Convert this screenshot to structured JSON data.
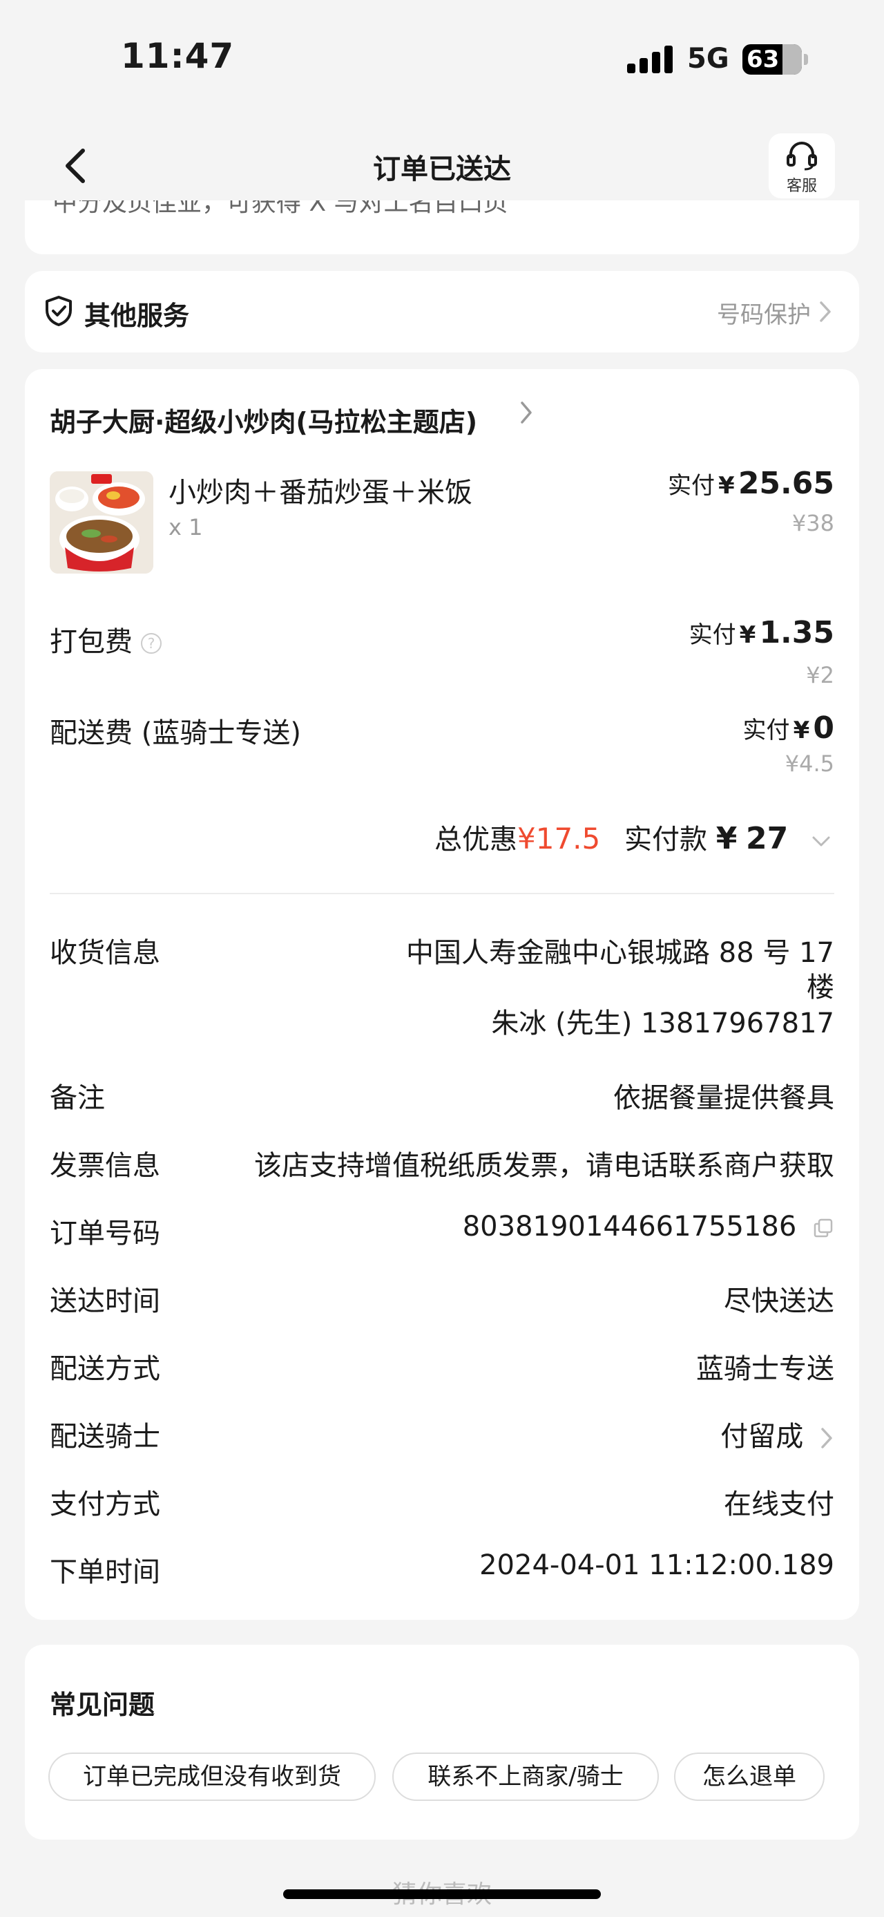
{
  "status_bar": {
    "time": "11:47",
    "network": "5G",
    "battery": "63"
  },
  "nav": {
    "title": "订单已送达",
    "service_label": "客服"
  },
  "partial_text": "中分及页佳业，可获得 X 与对工名目口页",
  "other_services": {
    "title": "其他服务",
    "link": "号码保护"
  },
  "shop": {
    "name": "胡子大厨·超级小炒肉(马拉松主题店)"
  },
  "item": {
    "name": "小炒肉＋番茄炒蛋＋米饭",
    "qty": "x 1",
    "paid_prefix": "实付",
    "paid_yen": "¥",
    "paid_amount": "25.65",
    "original": "¥38"
  },
  "packing_fee": {
    "label": "打包费",
    "paid_prefix": "实付",
    "paid_yen": "¥",
    "paid_amount": "1.35",
    "original": "¥2"
  },
  "delivery_fee": {
    "label": "配送费 (蓝骑士专送)",
    "paid_prefix": "实付",
    "paid_yen": "¥",
    "paid_amount": "0",
    "original": "¥4.5"
  },
  "totals": {
    "discount_label": "总优惠",
    "discount_value": "¥17.5",
    "pay_label": "实付款",
    "pay_yen": "¥",
    "pay_value": "27"
  },
  "info": {
    "address_label": "收货信息",
    "address_line1": "中国人寿金融中心银城路 88 号 17",
    "address_line2": "楼",
    "contact": "朱冰 (先生) 13817967817",
    "note_label": "备注",
    "note_value": "依据餐量提供餐具",
    "invoice_label": "发票信息",
    "invoice_value": "该店支持增值税纸质发票，请电话联系商户获取",
    "order_no_label": "订单号码",
    "order_no_value": "8038190144661755186",
    "delivery_time_label": "送达时间",
    "delivery_time_value": "尽快送达",
    "delivery_method_label": "配送方式",
    "delivery_method_value": "蓝骑士专送",
    "rider_label": "配送骑士",
    "rider_value": "付留成",
    "payment_label": "支付方式",
    "payment_value": "在线支付",
    "order_time_label": "下单时间",
    "order_time_value": "2024-04-01 11:12:00.189"
  },
  "faq": {
    "title": "常见问题",
    "chips": [
      "订单已完成但没有收到货",
      "联系不上商家/骑士",
      "怎么退单"
    ]
  },
  "footer": {
    "guess_title": "猜你喜欢"
  },
  "colors": {
    "accent_red": "#ef4a2f",
    "background": "#f4f4f4"
  }
}
